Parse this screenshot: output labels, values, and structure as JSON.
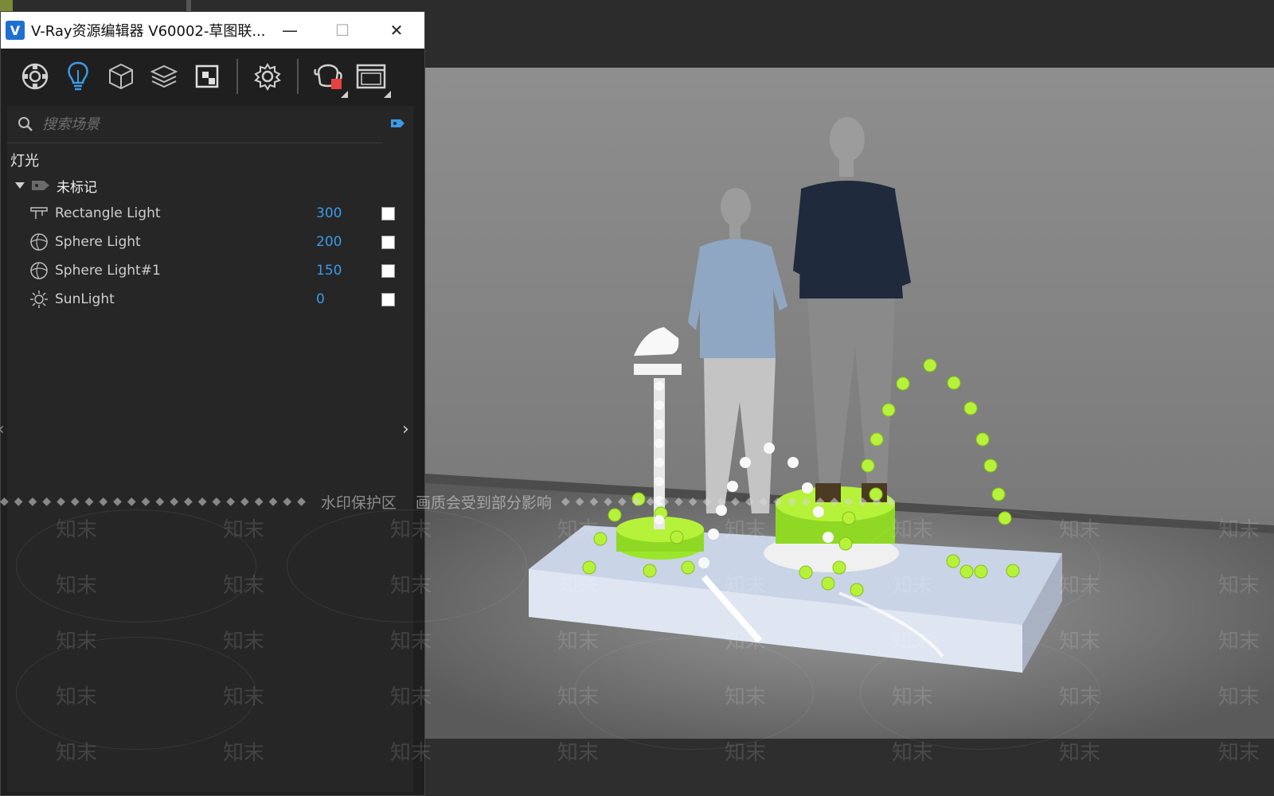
{
  "window": {
    "title": "V-Ray资源编辑器 V60002-草图联...",
    "minimize_glyph": "—",
    "maximize_glyph": "☐",
    "close_glyph": "✕"
  },
  "toolbar": {
    "buttons": [
      {
        "name": "materials",
        "icon": "material-sphere-icon"
      },
      {
        "name": "lights",
        "icon": "lightbulb-icon",
        "active": true
      },
      {
        "name": "geometry",
        "icon": "cube-icon"
      },
      {
        "name": "render-elements",
        "icon": "layers-icon"
      },
      {
        "name": "textures",
        "icon": "texture-icon"
      },
      {
        "name": "settings",
        "icon": "gear-icon"
      },
      {
        "name": "render",
        "icon": "teapot-render-icon"
      },
      {
        "name": "frame-buffer",
        "icon": "frame-buffer-icon"
      }
    ]
  },
  "search": {
    "placeholder": "搜索场景"
  },
  "lights_section": {
    "title": "灯光",
    "group_label": "未标记",
    "items": [
      {
        "name": "Rectangle Light",
        "value": "300",
        "icon": "rectangle-light-icon",
        "enabled": true
      },
      {
        "name": "Sphere Light",
        "value": "200",
        "icon": "sphere-light-icon",
        "enabled": true
      },
      {
        "name": "Sphere Light#1",
        "value": "150",
        "icon": "sphere-light-icon",
        "enabled": true
      },
      {
        "name": "SunLight",
        "value": "0",
        "icon": "sun-icon",
        "enabled": true
      }
    ]
  },
  "watermark": {
    "banner": "水印保护区",
    "banner2": "画质会受到部分影响",
    "mark": "知末"
  },
  "colors": {
    "accent": "#3b9ae6",
    "panel_bg": "#262626",
    "titlebar_bg": "#ffffff",
    "tennis_ball": "#b6f23a"
  }
}
